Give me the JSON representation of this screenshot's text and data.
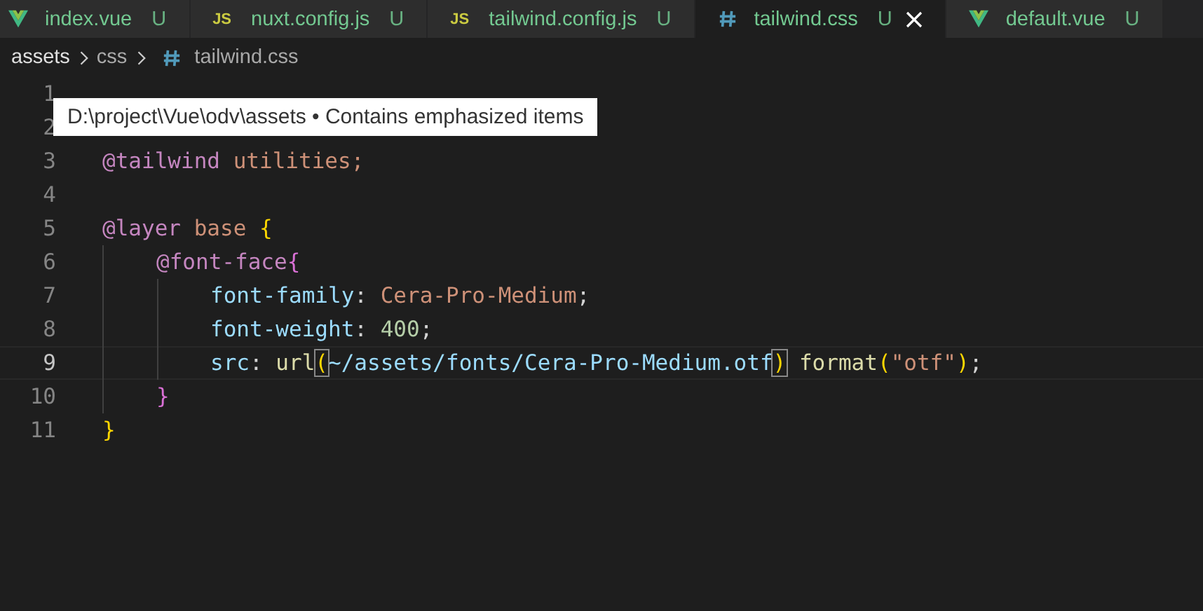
{
  "tabs": [
    {
      "label": "index.vue",
      "kind": "vue",
      "status": "U",
      "selected": false
    },
    {
      "label": "nuxt.config.js",
      "kind": "js",
      "badge": "JS",
      "status": "U",
      "selected": false
    },
    {
      "label": "tailwind.config.js",
      "kind": "js",
      "badge": "JS",
      "status": "U",
      "selected": false
    },
    {
      "label": "tailwind.css",
      "kind": "css",
      "status": "U",
      "selected": true
    },
    {
      "label": "default.vue",
      "kind": "vue",
      "status": "U",
      "selected": false
    }
  ],
  "breadcrumb": [
    {
      "label": "assets",
      "kind": "folder"
    },
    {
      "label": "css",
      "kind": "folder"
    },
    {
      "label": "tailwind.css",
      "kind": "css"
    }
  ],
  "tooltip": "D:\\project\\Vue\\odv\\assets • Contains emphasized items",
  "lines": [
    {
      "number": "1",
      "current": false
    },
    {
      "number": "2",
      "current": false
    },
    {
      "number": "3",
      "current": false,
      "tokens": [
        {
          "text": "@tailwind",
          "kind": "keyword"
        },
        {
          "text": " utilities;",
          "kind": "value"
        }
      ]
    },
    {
      "number": "4",
      "current": false
    },
    {
      "number": "5",
      "current": false,
      "tokens": [
        {
          "text": "@layer",
          "kind": "keyword"
        },
        {
          "text": " base ",
          "kind": "value"
        },
        {
          "text": "{",
          "kind": "brace1"
        }
      ],
      "children": [
        {
          "number": "6",
          "current": false,
          "tokens": [
            {
              "text": "@font-face",
              "kind": "keyword"
            },
            {
              "text": "{",
              "kind": "brace2"
            }
          ],
          "children": [
            {
              "number": "7",
              "current": false,
              "tokens": [
                {
                  "text": "font-family",
                  "kind": "property"
                },
                {
                  "text": ": ",
                  "kind": "plain"
                },
                {
                  "text": "Cera-Pro-Medium",
                  "kind": "value"
                },
                {
                  "text": ";",
                  "kind": "plain"
                }
              ]
            },
            {
              "number": "8",
              "current": false,
              "tokens": [
                {
                  "text": "font-weight",
                  "kind": "property"
                },
                {
                  "text": ": ",
                  "kind": "plain"
                },
                {
                  "text": "400",
                  "kind": "number"
                },
                {
                  "text": ";",
                  "kind": "plain"
                }
              ]
            },
            {
              "number": "9",
              "current": true,
              "tokens": [
                {
                  "text": "src",
                  "kind": "property"
                },
                {
                  "text": ": ",
                  "kind": "plain"
                },
                {
                  "text": "url",
                  "kind": "function"
                },
                {
                  "text": "(",
                  "kind": "bracket-match"
                },
                {
                  "text": "~/assets/fonts/Cera-Pro-Medium.otf",
                  "kind": "property"
                },
                {
                  "text": ")",
                  "kind": "bracket-match"
                },
                {
                  "text": " format",
                  "kind": "function"
                },
                {
                  "text": "(",
                  "kind": "brace1"
                },
                {
                  "text": "\"otf\"",
                  "kind": "value"
                },
                {
                  "text": ")",
                  "kind": "brace1"
                },
                {
                  "text": ";",
                  "kind": "plain"
                }
              ]
            }
          ]
        },
        {
          "number": "10",
          "current": false,
          "tokens": [
            {
              "text": "}",
              "kind": "brace2"
            }
          ]
        }
      ]
    },
    {
      "number": "11",
      "current": false,
      "tokens": [
        {
          "text": "}",
          "kind": "brace1"
        }
      ]
    }
  ]
}
